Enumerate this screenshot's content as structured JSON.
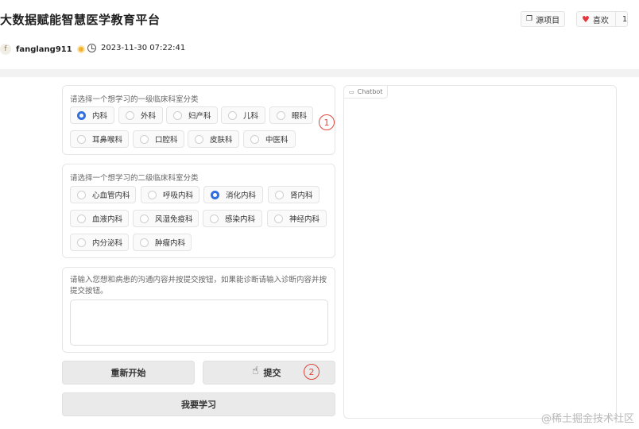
{
  "header": {
    "title": "大数据赋能智慧医学教育平台",
    "source_btn": "源项目",
    "like_btn": "喜欢",
    "like_count": "1",
    "author": "fanglang911",
    "author_initial": "f",
    "timestamp": "2023-11-30 07:22:41"
  },
  "group1": {
    "label": "请选择一个想学习的一级临床科室分类",
    "options": [
      "内科",
      "外科",
      "妇产科",
      "儿科",
      "眼科",
      "耳鼻喉科",
      "口腔科",
      "皮肤科",
      "中医科"
    ],
    "selected": "内科",
    "marker": "1"
  },
  "group2": {
    "label": "请选择一个想学习的二级临床科室分类",
    "options": [
      "心血管内科",
      "呼吸内科",
      "消化内科",
      "肾内科",
      "血液内科",
      "风湿免疫科",
      "感染内科",
      "神经内科",
      "内分泌科",
      "肿瘤内科"
    ],
    "selected": "消化内科"
  },
  "input_box": {
    "label": "请输入您想和病患的沟通内容并按提交按钮，如果能诊断请输入诊断内容并按提交按钮。",
    "value": ""
  },
  "buttons": {
    "restart": "重新开始",
    "submit": "提交",
    "submit_marker": "2",
    "learn": "我要学习"
  },
  "chatbot": {
    "label": "Chatbot"
  },
  "watermark": "@稀土掘金技术社区"
}
